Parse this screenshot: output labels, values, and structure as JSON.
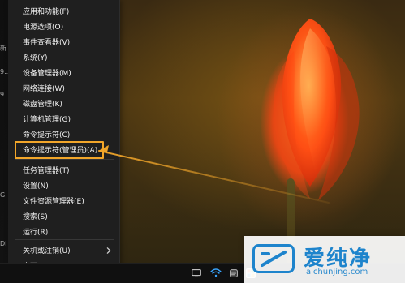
{
  "desktop": {
    "edge_text": [
      "新",
      "9...",
      "9.",
      "Gi",
      "Di"
    ]
  },
  "winx_menu": {
    "items": [
      {
        "label": "应用和功能(F)"
      },
      {
        "label": "电源选项(O)"
      },
      {
        "label": "事件查看器(V)"
      },
      {
        "label": "系统(Y)"
      },
      {
        "label": "设备管理器(M)"
      },
      {
        "label": "网络连接(W)"
      },
      {
        "label": "磁盘管理(K)"
      },
      {
        "label": "计算机管理(G)"
      },
      {
        "label": "命令提示符(C)"
      },
      {
        "label": "命令提示符(管理员)(A)"
      },
      {
        "label": "任务管理器(T)"
      },
      {
        "label": "设置(N)"
      },
      {
        "label": "文件资源管理器(E)"
      },
      {
        "label": "搜索(S)"
      },
      {
        "label": "运行(R)"
      },
      {
        "label": "关机或注销(U)",
        "has_submenu": true
      },
      {
        "label": "桌面(D)"
      }
    ]
  },
  "annotation": {
    "highlight_color": "#f2a62a"
  },
  "taskbar": {
    "icons": [
      "monitor-icon",
      "wifi-icon",
      "notification-icon",
      "app-icon"
    ]
  },
  "watermark": {
    "title": "爱纯净",
    "subtitle": "aichunjing.com",
    "color": "#1e84cc"
  }
}
